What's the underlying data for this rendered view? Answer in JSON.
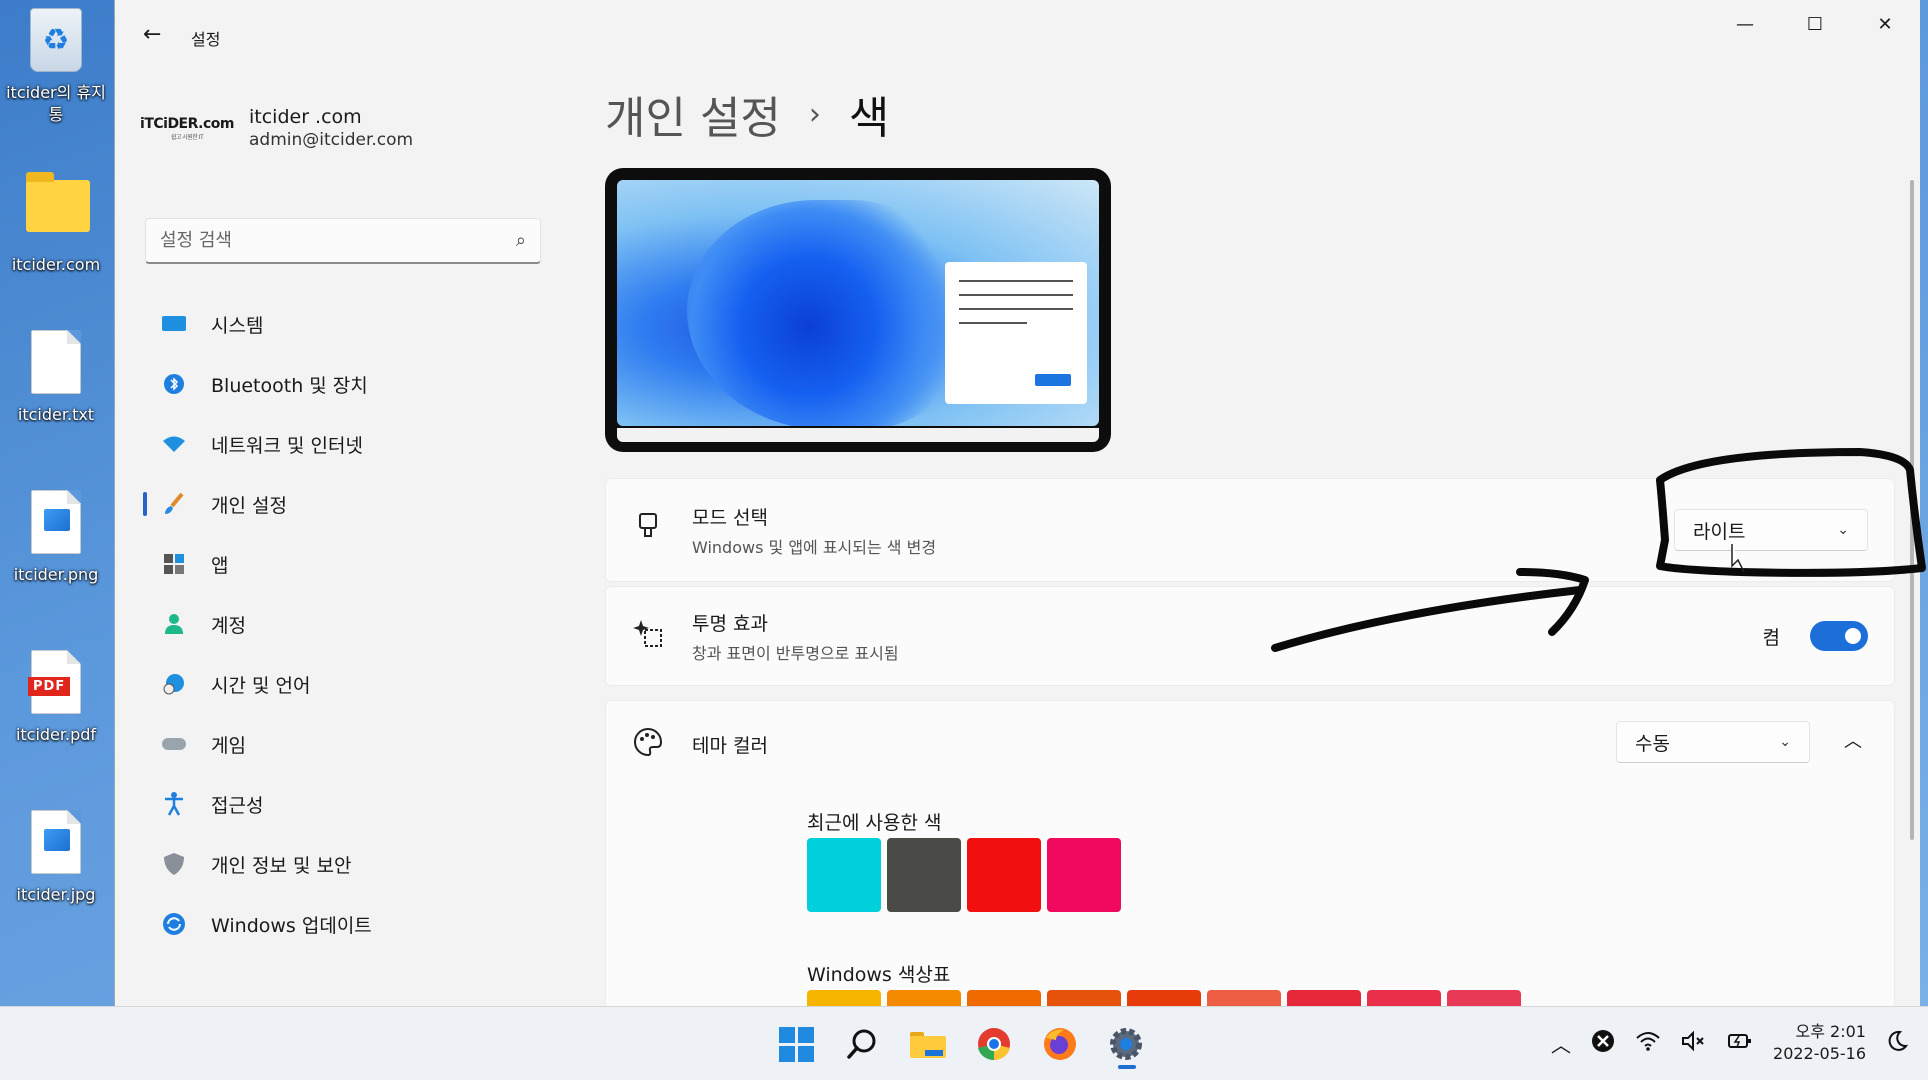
{
  "desktop": {
    "icons": [
      {
        "label": "itcider의 휴지통"
      },
      {
        "label": "itcider.com"
      },
      {
        "label": "itcider.txt"
      },
      {
        "label": "itcider.png"
      },
      {
        "label": "itcider.pdf",
        "badge": "PDF"
      },
      {
        "label": "itcider.jpg"
      }
    ]
  },
  "window": {
    "title": "설정",
    "controls": {
      "minimize": "—",
      "maximize": "☐",
      "close": "✕"
    }
  },
  "profile": {
    "logo": "iTCiDER.com",
    "logo_sub": "쉽고 시원한 IT",
    "name": "itcider .com",
    "email": "admin@itcider.com"
  },
  "search": {
    "placeholder": "설정 검색"
  },
  "nav": {
    "items": [
      {
        "label": "시스템",
        "icon": "monitor-icon"
      },
      {
        "label": "Bluetooth 및 장치",
        "icon": "bluetooth-icon"
      },
      {
        "label": "네트워크 및 인터넷",
        "icon": "wifi-icon"
      },
      {
        "label": "개인 설정",
        "icon": "brush-icon",
        "active": true
      },
      {
        "label": "앱",
        "icon": "apps-icon"
      },
      {
        "label": "계정",
        "icon": "account-icon"
      },
      {
        "label": "시간 및 언어",
        "icon": "globe-clock-icon"
      },
      {
        "label": "게임",
        "icon": "gamepad-icon"
      },
      {
        "label": "접근성",
        "icon": "accessibility-icon"
      },
      {
        "label": "개인 정보 및 보안",
        "icon": "shield-icon"
      },
      {
        "label": "Windows 업데이트",
        "icon": "update-icon"
      }
    ]
  },
  "breadcrumb": {
    "parent": "개인 설정",
    "separator": "›",
    "current": "색"
  },
  "mode": {
    "title": "모드 선택",
    "subtitle": "Windows 및 앱에 표시되는 색 변경",
    "value": "라이트"
  },
  "transparency": {
    "title": "투명 효과",
    "subtitle": "창과 표면이 반투명으로 표시됨",
    "state_label": "켬",
    "on": true
  },
  "accent": {
    "title": "테마 컬러",
    "value": "수동"
  },
  "recent_colors": {
    "label": "최근에 사용한 색",
    "colors": [
      "#00cfdc",
      "#4a4a47",
      "#f20f0f",
      "#f0095f"
    ]
  },
  "palette": {
    "label": "Windows 색상표",
    "colors": [
      "#f7b500",
      "#f58a00",
      "#ef6a00",
      "#e6520a",
      "#e83b0c",
      "#ee5e45",
      "#e6283a",
      "#ea2f4b",
      "#e83a57"
    ]
  },
  "tray": {
    "time": "오후 2:01",
    "date": "2022-05-16"
  }
}
